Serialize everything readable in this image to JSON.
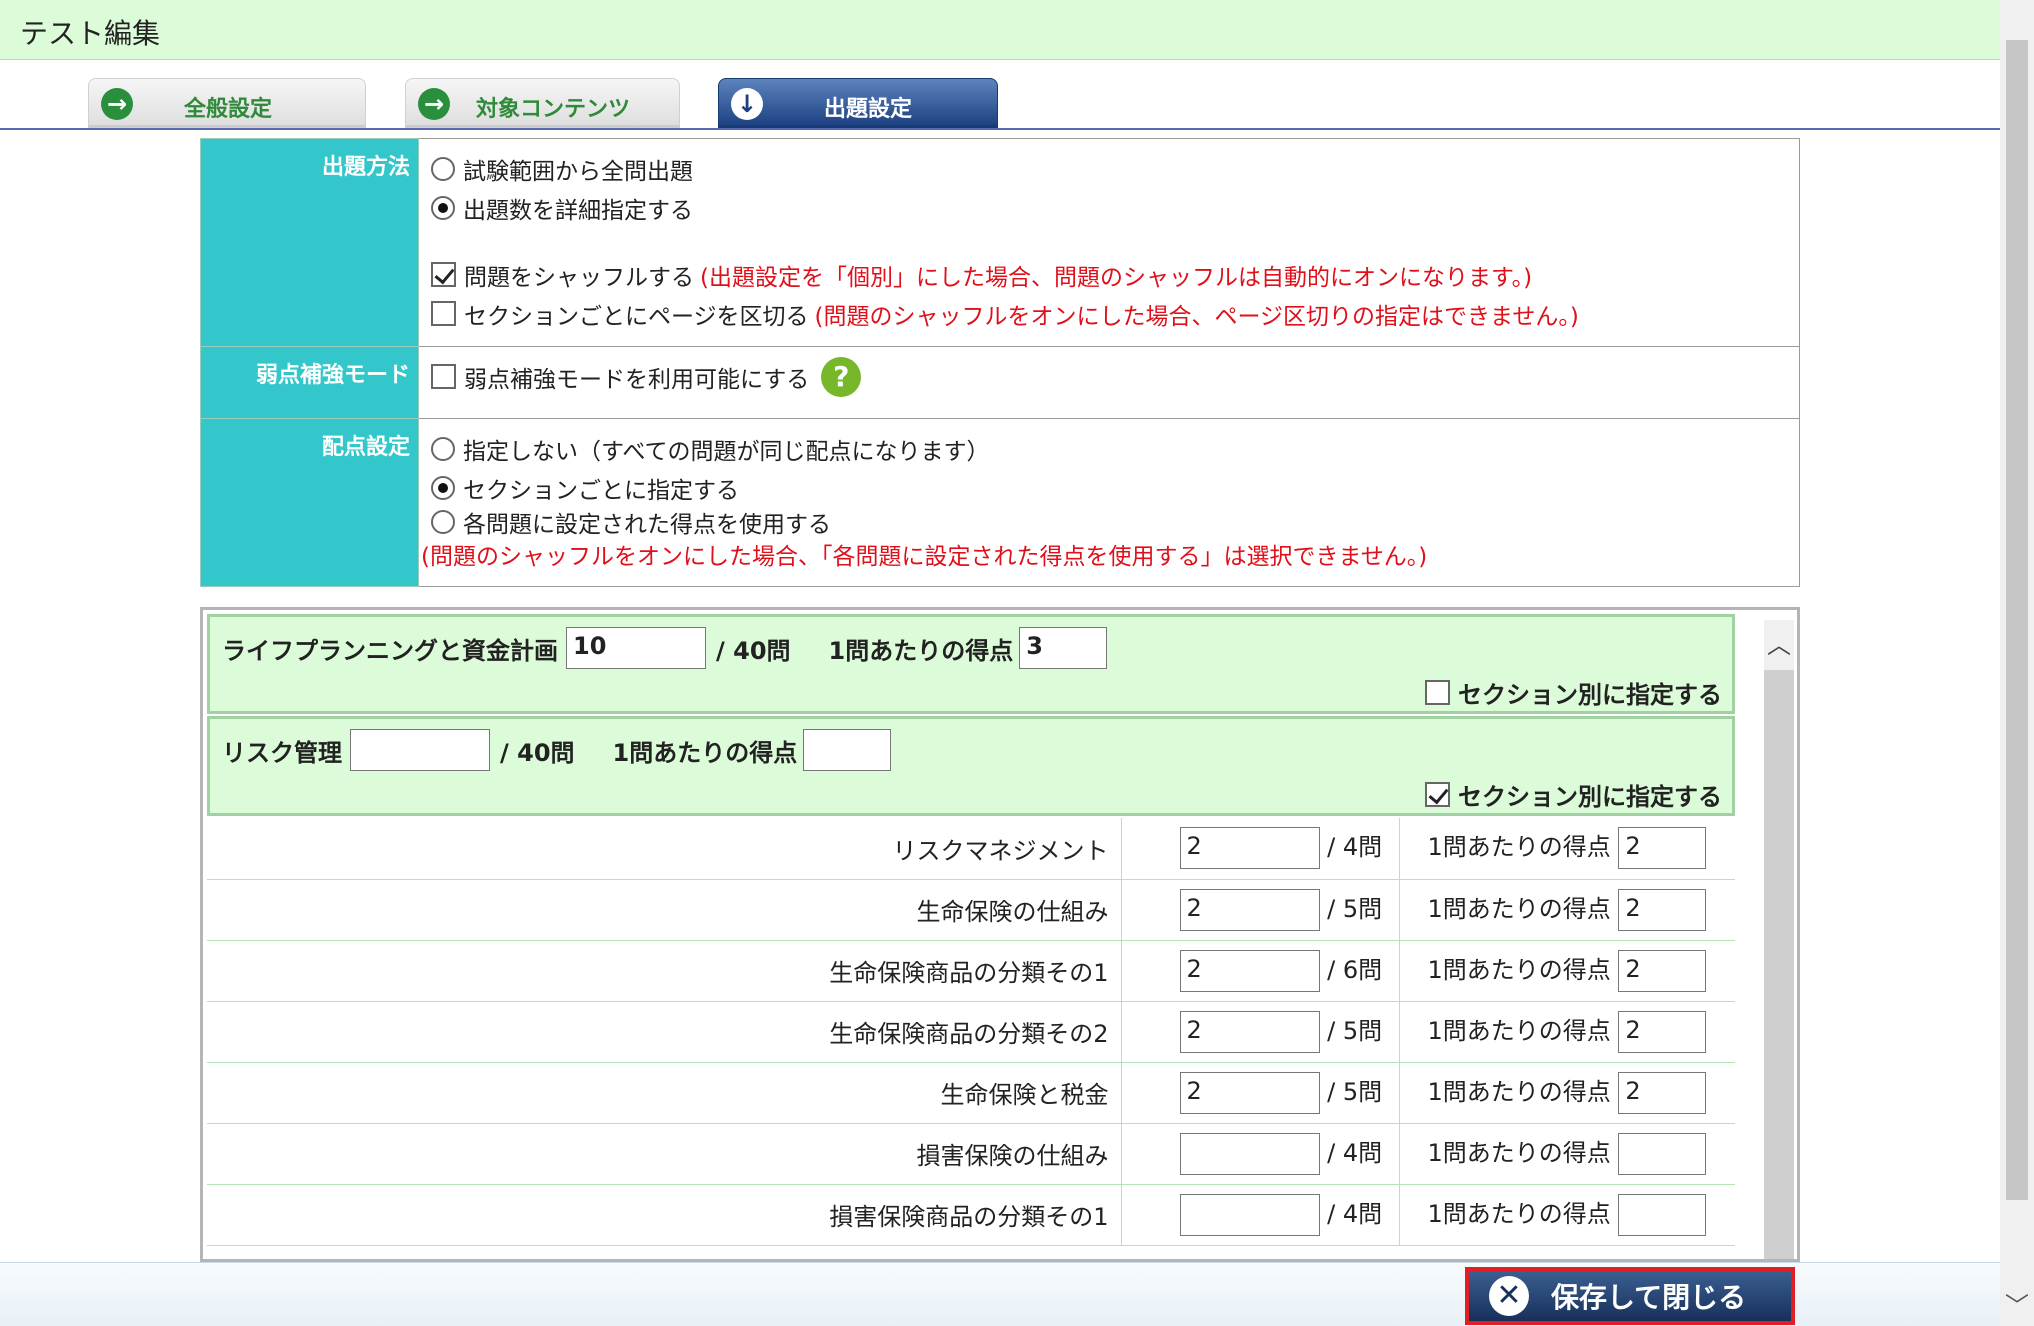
{
  "window": {
    "title": "テスト編集"
  },
  "tabs": [
    {
      "label": "全般設定",
      "icon": "arrow-right-icon"
    },
    {
      "label": "対象コンテンツ",
      "icon": "arrow-right-icon"
    },
    {
      "label": "出題設定",
      "icon": "arrow-down-icon"
    }
  ],
  "settings": {
    "method": {
      "header": "出題方法",
      "opt_all": "試験範囲から全問出題",
      "opt_detail": "出題数を詳細指定する",
      "shuffle": "問題をシャッフルする",
      "shuffle_note": "(出題設定を「個別」にした場合、問題のシャッフルは自動的にオンになります。)",
      "page_break": "セクションごとにページを区切る",
      "page_break_note": "(問題のシャッフルをオンにした場合、ページ区切りの指定はできません。)"
    },
    "weak": {
      "header": "弱点補強モード",
      "label": "弱点補強モードを利用可能にする",
      "help": "?"
    },
    "score": {
      "header": "配点設定",
      "opt_none": "指定しない（すべての問題が同じ配点になります）",
      "opt_section": "セクションごとに指定する",
      "opt_each": "各問題に設定された得点を使用する",
      "note": "(問題のシャッフルをオンにした場合、「各問題に設定された得点を使用する」は選択できません。)"
    }
  },
  "sections": [
    {
      "name": "ライフプランニングと資金計画",
      "count": "10",
      "total": "/ 40問",
      "per_label": "1問あたりの得点",
      "per": "3",
      "check_label": "セクション別に指定する"
    },
    {
      "name": "リスク管理",
      "count": "",
      "total": "/ 40問",
      "per_label": "1問あたりの得点",
      "per": "",
      "check_label": "セクション別に指定する"
    }
  ],
  "subsections": [
    {
      "name": "リスクマネジメント",
      "count": "2",
      "total": "/ 4問",
      "per_label": "1問あたりの得点",
      "per": "2"
    },
    {
      "name": "生命保険の仕組み",
      "count": "2",
      "total": "/ 5問",
      "per_label": "1問あたりの得点",
      "per": "2"
    },
    {
      "name": "生命保険商品の分類その1",
      "count": "2",
      "total": "/ 6問",
      "per_label": "1問あたりの得点",
      "per": "2"
    },
    {
      "name": "生命保険商品の分類その2",
      "count": "2",
      "total": "/ 5問",
      "per_label": "1問あたりの得点",
      "per": "2"
    },
    {
      "name": "生命保険と税金",
      "count": "2",
      "total": "/ 5問",
      "per_label": "1問あたりの得点",
      "per": "2"
    },
    {
      "name": "損害保険の仕組み",
      "count": "",
      "total": "/ 4問",
      "per_label": "1問あたりの得点",
      "per": ""
    },
    {
      "name": "損害保険商品の分類その1",
      "count": "",
      "total": "/ 4問",
      "per_label": "1問あたりの得点",
      "per": ""
    }
  ],
  "footer": {
    "save_label": "保存して閉じる"
  }
}
